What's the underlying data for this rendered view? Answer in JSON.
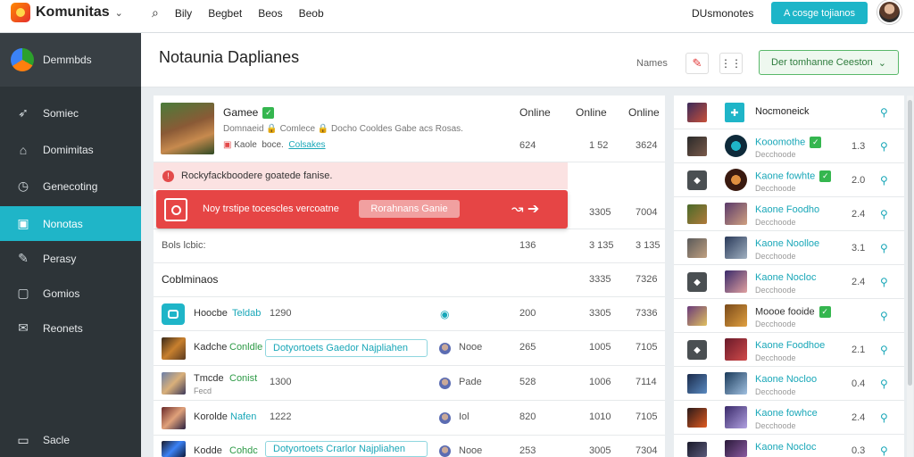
{
  "app": {
    "name": "Komunitas"
  },
  "topnav": {
    "items": [
      "Bily",
      "Begbet",
      "Beos",
      "Beob"
    ]
  },
  "topbar": {
    "right_label": "DUsmonotes",
    "cta_label": "A cosge tojianos"
  },
  "sidebar": {
    "header": "Demmbds",
    "items": [
      {
        "label": "Somiec",
        "icon": "rocket-icon"
      },
      {
        "label": "Domimitas",
        "icon": "home-icon"
      },
      {
        "label": "Genecoting",
        "icon": "clock-icon"
      },
      {
        "label": "Nonotas",
        "icon": "bag-icon",
        "active": true
      },
      {
        "label": "Perasy",
        "icon": "pin-icon"
      },
      {
        "label": "Gomios",
        "icon": "box-icon"
      },
      {
        "label": "Reonets",
        "icon": "mail-icon"
      }
    ],
    "bottom": {
      "label": "Sacle",
      "icon": "monitor-icon"
    }
  },
  "page": {
    "title": "Notaunia Daplianes",
    "label": "Names",
    "dropdown": "Der tomhanne Ceeston"
  },
  "table": {
    "headers": [
      "Online",
      "Online",
      "Online"
    ],
    "featured": {
      "title": "Gamee",
      "description": "Domnaeid 🔒 Comlece 🔒 Docho Cooldes Gabe acs Rosas.",
      "meta_prefix": "Kaole",
      "meta_middle": "boce.",
      "meta_link": "Colsakes",
      "v1": "624",
      "v2": "1 52",
      "v3": "3624"
    },
    "alert_soft": "Rockyfackboodere goatede fanise.",
    "alert_strong": {
      "message": "Noy trstipe tocescles vercoatne",
      "button": "Rorahnans Ganie"
    },
    "row_alert": {
      "v1": "3305",
      "v2": "7004"
    },
    "row_b": {
      "label": "Bols lcbic:",
      "v1": "136",
      "v2": "3 135",
      "v3": "3 135"
    },
    "section": {
      "label": "Coblminaos",
      "v1": "3335",
      "v2": "7326"
    },
    "rows": [
      {
        "name": "Hoocbe",
        "tag": "Teldab",
        "time": "1290",
        "pill": "",
        "user": "",
        "v1": "200",
        "v2": "3305",
        "v3": "7336"
      },
      {
        "name": "Kadche",
        "tag": "Conldle",
        "time": "",
        "pill": "Dotyortoets Gaedor Najpliahen",
        "user": "Nooe",
        "v1": "265",
        "v2": "1005",
        "v3": "7105"
      },
      {
        "name": "Tmcde",
        "tag": "Conist",
        "sub": "Fecd",
        "time": "1300",
        "pill": "",
        "user": "Pade",
        "v1": "528",
        "v2": "1006",
        "v3": "7114"
      },
      {
        "name": "Korolde",
        "tag": "Nafen",
        "time": "1222",
        "pill": "",
        "user": "Iol",
        "v1": "820",
        "v2": "1010",
        "v3": "7105"
      },
      {
        "name": "Kodde",
        "tag": "Cohdc",
        "time": "",
        "pill": "Dotyortoets Crarlor Najpliahen",
        "user": "Nooe",
        "v1": "253",
        "v2": "3005",
        "v3": "7304"
      }
    ]
  },
  "right_panel": {
    "header": "Nocmoneick",
    "rows": [
      {
        "name": "Kooomothe",
        "sub": "Decchoode",
        "badge": true,
        "value": "1.3"
      },
      {
        "name": "Kaone fowhte",
        "sub": "Decchoode",
        "badge": true,
        "value": "2.0"
      },
      {
        "name": "Kaone Foodho",
        "sub": "Decchoode",
        "badge": false,
        "value": "2.4"
      },
      {
        "name": "Kaone Noolloe",
        "sub": "Decchoode",
        "badge": false,
        "value": "3.1"
      },
      {
        "name": "Kaone Nocloc",
        "sub": "Decchoode",
        "badge": false,
        "value": "2.4"
      },
      {
        "name": "Moooe fooide",
        "sub": "Decchoode",
        "badge": true,
        "value": ""
      },
      {
        "name": "Kaone Foodhoe",
        "sub": "Decchoode",
        "badge": false,
        "value": "2.1"
      },
      {
        "name": "Kaone Nocloo",
        "sub": "Decchoode",
        "badge": false,
        "value": "0.4"
      },
      {
        "name": "Kaone fowhce",
        "sub": "Decchoode",
        "badge": false,
        "value": "2.4"
      },
      {
        "name": "Kaone Nocloc",
        "sub": "Decchoode",
        "badge": false,
        "value": "0.3"
      }
    ]
  },
  "colors": {
    "accent": "#1fb5c8",
    "sidebar": "#2d3438",
    "alert": "#e64545",
    "success": "#35b64f"
  }
}
